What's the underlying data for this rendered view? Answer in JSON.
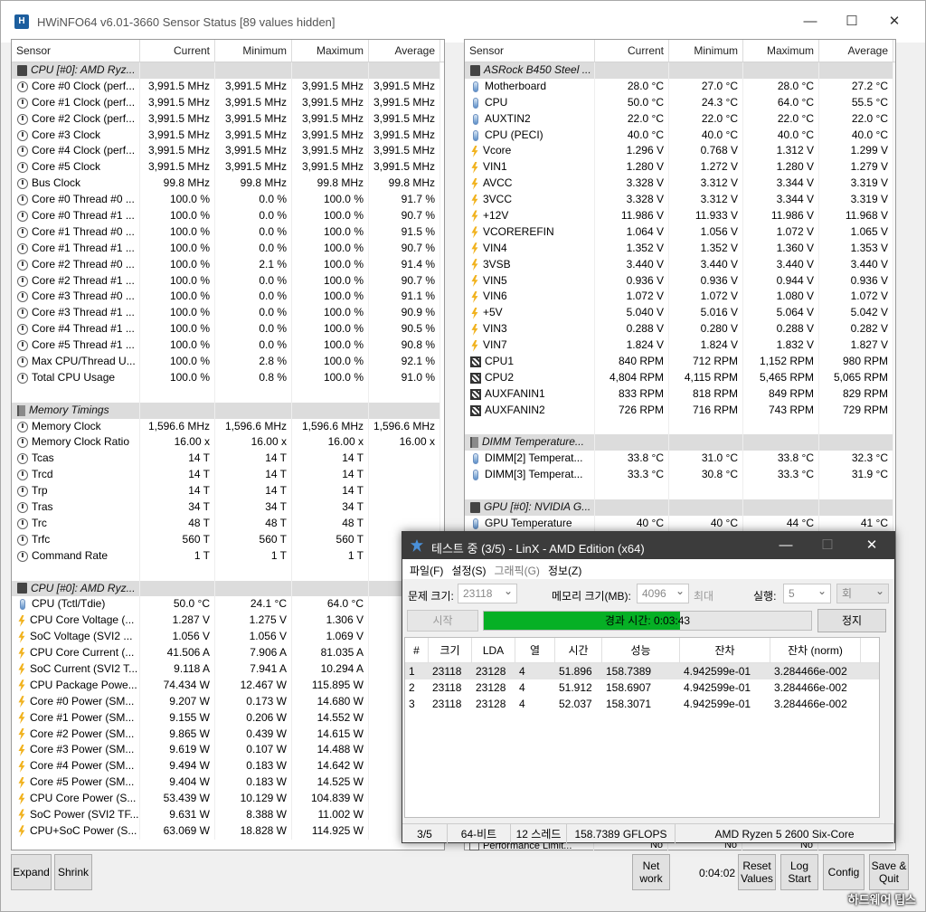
{
  "hwinfo": {
    "title": "HWiNFO64 v6.01-3660 Sensor Status [89 values hidden]",
    "app_icon_text": "H",
    "headers": [
      "Sensor",
      "Current",
      "Minimum",
      "Maximum",
      "Average"
    ],
    "left_rows": [
      {
        "t": "g",
        "icon": "chip",
        "name": "CPU [#0]: AMD Ryz..."
      },
      {
        "icon": "clock",
        "name": "Core #0 Clock (perf...",
        "cur": "3,991.5 MHz",
        "min": "3,991.5 MHz",
        "max": "3,991.5 MHz",
        "avg": "3,991.5 MHz"
      },
      {
        "icon": "clock",
        "name": "Core #1 Clock (perf...",
        "cur": "3,991.5 MHz",
        "min": "3,991.5 MHz",
        "max": "3,991.5 MHz",
        "avg": "3,991.5 MHz"
      },
      {
        "icon": "clock",
        "name": "Core #2 Clock (perf...",
        "cur": "3,991.5 MHz",
        "min": "3,991.5 MHz",
        "max": "3,991.5 MHz",
        "avg": "3,991.5 MHz"
      },
      {
        "icon": "clock",
        "name": "Core #3 Clock",
        "cur": "3,991.5 MHz",
        "min": "3,991.5 MHz",
        "max": "3,991.5 MHz",
        "avg": "3,991.5 MHz"
      },
      {
        "icon": "clock",
        "name": "Core #4 Clock (perf...",
        "cur": "3,991.5 MHz",
        "min": "3,991.5 MHz",
        "max": "3,991.5 MHz",
        "avg": "3,991.5 MHz"
      },
      {
        "icon": "clock",
        "name": "Core #5 Clock",
        "cur": "3,991.5 MHz",
        "min": "3,991.5 MHz",
        "max": "3,991.5 MHz",
        "avg": "3,991.5 MHz"
      },
      {
        "icon": "clock",
        "name": "Bus Clock",
        "cur": "99.8 MHz",
        "min": "99.8 MHz",
        "max": "99.8 MHz",
        "avg": "99.8 MHz"
      },
      {
        "icon": "clock",
        "name": "Core #0 Thread #0 ...",
        "cur": "100.0 %",
        "min": "0.0 %",
        "max": "100.0 %",
        "avg": "91.7 %"
      },
      {
        "icon": "clock",
        "name": "Core #0 Thread #1 ...",
        "cur": "100.0 %",
        "min": "0.0 %",
        "max": "100.0 %",
        "avg": "90.7 %"
      },
      {
        "icon": "clock",
        "name": "Core #1 Thread #0 ...",
        "cur": "100.0 %",
        "min": "0.0 %",
        "max": "100.0 %",
        "avg": "91.5 %"
      },
      {
        "icon": "clock",
        "name": "Core #1 Thread #1 ...",
        "cur": "100.0 %",
        "min": "0.0 %",
        "max": "100.0 %",
        "avg": "90.7 %"
      },
      {
        "icon": "clock",
        "name": "Core #2 Thread #0 ...",
        "cur": "100.0 %",
        "min": "2.1 %",
        "max": "100.0 %",
        "avg": "91.4 %"
      },
      {
        "icon": "clock",
        "name": "Core #2 Thread #1 ...",
        "cur": "100.0 %",
        "min": "0.0 %",
        "max": "100.0 %",
        "avg": "90.7 %"
      },
      {
        "icon": "clock",
        "name": "Core #3 Thread #0 ...",
        "cur": "100.0 %",
        "min": "0.0 %",
        "max": "100.0 %",
        "avg": "91.1 %"
      },
      {
        "icon": "clock",
        "name": "Core #3 Thread #1 ...",
        "cur": "100.0 %",
        "min": "0.0 %",
        "max": "100.0 %",
        "avg": "90.9 %"
      },
      {
        "icon": "clock",
        "name": "Core #4 Thread #1 ...",
        "cur": "100.0 %",
        "min": "0.0 %",
        "max": "100.0 %",
        "avg": "90.5 %"
      },
      {
        "icon": "clock",
        "name": "Core #5 Thread #1 ...",
        "cur": "100.0 %",
        "min": "0.0 %",
        "max": "100.0 %",
        "avg": "90.8 %"
      },
      {
        "icon": "clock",
        "name": "Max CPU/Thread U...",
        "cur": "100.0 %",
        "min": "2.8 %",
        "max": "100.0 %",
        "avg": "92.1 %"
      },
      {
        "icon": "clock",
        "name": "Total CPU Usage",
        "cur": "100.0 %",
        "min": "0.8 %",
        "max": "100.0 %",
        "avg": "91.0 %"
      },
      {
        "t": "e"
      },
      {
        "t": "g",
        "icon": "mem",
        "name": "Memory Timings"
      },
      {
        "icon": "clock",
        "name": "Memory Clock",
        "cur": "1,596.6 MHz",
        "min": "1,596.6 MHz",
        "max": "1,596.6 MHz",
        "avg": "1,596.6 MHz"
      },
      {
        "icon": "clock",
        "name": "Memory Clock Ratio",
        "cur": "16.00 x",
        "min": "16.00 x",
        "max": "16.00 x",
        "avg": "16.00 x"
      },
      {
        "icon": "clock",
        "name": "Tcas",
        "cur": "14 T",
        "min": "14 T",
        "max": "14 T",
        "avg": ""
      },
      {
        "icon": "clock",
        "name": "Trcd",
        "cur": "14 T",
        "min": "14 T",
        "max": "14 T",
        "avg": ""
      },
      {
        "icon": "clock",
        "name": "Trp",
        "cur": "14 T",
        "min": "14 T",
        "max": "14 T",
        "avg": ""
      },
      {
        "icon": "clock",
        "name": "Tras",
        "cur": "34 T",
        "min": "34 T",
        "max": "34 T",
        "avg": ""
      },
      {
        "icon": "clock",
        "name": "Trc",
        "cur": "48 T",
        "min": "48 T",
        "max": "48 T",
        "avg": ""
      },
      {
        "icon": "clock",
        "name": "Trfc",
        "cur": "560 T",
        "min": "560 T",
        "max": "560 T",
        "avg": ""
      },
      {
        "icon": "clock",
        "name": "Command Rate",
        "cur": "1 T",
        "min": "1 T",
        "max": "1 T",
        "avg": ""
      },
      {
        "t": "e"
      },
      {
        "t": "g",
        "icon": "chip",
        "name": "CPU [#0]: AMD Ryz..."
      },
      {
        "icon": "therm",
        "name": "CPU (Tctl/Tdie)",
        "cur": "50.0 °C",
        "min": "24.1 °C",
        "max": "64.0 °C",
        "avg": ""
      },
      {
        "icon": "volt",
        "name": "CPU Core Voltage (...",
        "cur": "1.287 V",
        "min": "1.275 V",
        "max": "1.306 V",
        "avg": ""
      },
      {
        "icon": "volt",
        "name": "SoC Voltage (SVI2 ...",
        "cur": "1.056 V",
        "min": "1.056 V",
        "max": "1.069 V",
        "avg": ""
      },
      {
        "icon": "volt",
        "name": "CPU Core Current (...",
        "cur": "41.506 A",
        "min": "7.906 A",
        "max": "81.035 A",
        "avg": "6"
      },
      {
        "icon": "volt",
        "name": "SoC Current (SVI2 T...",
        "cur": "9.118 A",
        "min": "7.941 A",
        "max": "10.294 A",
        "avg": ""
      },
      {
        "icon": "volt",
        "name": "CPU Package Powe...",
        "cur": "74.434 W",
        "min": "12.467 W",
        "max": "115.895 W",
        "avg": "9"
      },
      {
        "icon": "volt",
        "name": "Core #0 Power (SM...",
        "cur": "9.207 W",
        "min": "0.173 W",
        "max": "14.680 W",
        "avg": "1"
      },
      {
        "icon": "volt",
        "name": "Core #1 Power (SM...",
        "cur": "9.155 W",
        "min": "0.206 W",
        "max": "14.552 W",
        "avg": "1"
      },
      {
        "icon": "volt",
        "name": "Core #2 Power (SM...",
        "cur": "9.865 W",
        "min": "0.439 W",
        "max": "14.615 W",
        "avg": "1"
      },
      {
        "icon": "volt",
        "name": "Core #3 Power (SM...",
        "cur": "9.619 W",
        "min": "0.107 W",
        "max": "14.488 W",
        "avg": "1"
      },
      {
        "icon": "volt",
        "name": "Core #4 Power (SM...",
        "cur": "9.494 W",
        "min": "0.183 W",
        "max": "14.642 W",
        "avg": "1"
      },
      {
        "icon": "volt",
        "name": "Core #5 Power (SM...",
        "cur": "9.404 W",
        "min": "0.183 W",
        "max": "14.525 W",
        "avg": "1"
      },
      {
        "icon": "volt",
        "name": "CPU Core Power (S...",
        "cur": "53.439 W",
        "min": "10.129 W",
        "max": "104.839 W",
        "avg": "7"
      },
      {
        "icon": "volt",
        "name": "SoC Power (SVI2 TF...",
        "cur": "9.631 W",
        "min": "8.388 W",
        "max": "11.002 W",
        "avg": "9"
      },
      {
        "icon": "volt",
        "name": "CPU+SoC Power (S...",
        "cur": "63.069 W",
        "min": "18.828 W",
        "max": "114.925 W",
        "avg": "8"
      }
    ],
    "right_rows": [
      {
        "t": "g",
        "icon": "chip",
        "name": "ASRock B450 Steel ..."
      },
      {
        "icon": "therm",
        "name": "Motherboard",
        "cur": "28.0 °C",
        "min": "27.0 °C",
        "max": "28.0 °C",
        "avg": "27.2 °C"
      },
      {
        "icon": "therm",
        "name": "CPU",
        "cur": "50.0 °C",
        "min": "24.3 °C",
        "max": "64.0 °C",
        "avg": "55.5 °C"
      },
      {
        "icon": "therm",
        "name": "AUXTIN2",
        "cur": "22.0 °C",
        "min": "22.0 °C",
        "max": "22.0 °C",
        "avg": "22.0 °C"
      },
      {
        "icon": "therm",
        "name": "CPU (PECI)",
        "cur": "40.0 °C",
        "min": "40.0 °C",
        "max": "40.0 °C",
        "avg": "40.0 °C"
      },
      {
        "icon": "volt",
        "name": "Vcore",
        "cur": "1.296 V",
        "min": "0.768 V",
        "max": "1.312 V",
        "avg": "1.299 V"
      },
      {
        "icon": "volt",
        "name": "VIN1",
        "cur": "1.280 V",
        "min": "1.272 V",
        "max": "1.280 V",
        "avg": "1.279 V"
      },
      {
        "icon": "volt",
        "name": "AVCC",
        "cur": "3.328 V",
        "min": "3.312 V",
        "max": "3.344 V",
        "avg": "3.319 V"
      },
      {
        "icon": "volt",
        "name": "3VCC",
        "cur": "3.328 V",
        "min": "3.312 V",
        "max": "3.344 V",
        "avg": "3.319 V"
      },
      {
        "icon": "volt",
        "name": "+12V",
        "cur": "11.986 V",
        "min": "11.933 V",
        "max": "11.986 V",
        "avg": "11.968 V"
      },
      {
        "icon": "volt",
        "name": "VCOREREFIN",
        "cur": "1.064 V",
        "min": "1.056 V",
        "max": "1.072 V",
        "avg": "1.065 V"
      },
      {
        "icon": "volt",
        "name": "VIN4",
        "cur": "1.352 V",
        "min": "1.352 V",
        "max": "1.360 V",
        "avg": "1.353 V"
      },
      {
        "icon": "volt",
        "name": "3VSB",
        "cur": "3.440 V",
        "min": "3.440 V",
        "max": "3.440 V",
        "avg": "3.440 V"
      },
      {
        "icon": "volt",
        "name": "VIN5",
        "cur": "0.936 V",
        "min": "0.936 V",
        "max": "0.944 V",
        "avg": "0.936 V"
      },
      {
        "icon": "volt",
        "name": "VIN6",
        "cur": "1.072 V",
        "min": "1.072 V",
        "max": "1.080 V",
        "avg": "1.072 V"
      },
      {
        "icon": "volt",
        "name": "+5V",
        "cur": "5.040 V",
        "min": "5.016 V",
        "max": "5.064 V",
        "avg": "5.042 V"
      },
      {
        "icon": "volt",
        "name": "VIN3",
        "cur": "0.288 V",
        "min": "0.280 V",
        "max": "0.288 V",
        "avg": "0.282 V"
      },
      {
        "icon": "volt",
        "name": "VIN7",
        "cur": "1.824 V",
        "min": "1.824 V",
        "max": "1.832 V",
        "avg": "1.827 V"
      },
      {
        "icon": "fan",
        "name": "CPU1",
        "cur": "840 RPM",
        "min": "712 RPM",
        "max": "1,152 RPM",
        "avg": "980 RPM"
      },
      {
        "icon": "fan",
        "name": "CPU2",
        "cur": "4,804 RPM",
        "min": "4,115 RPM",
        "max": "5,465 RPM",
        "avg": "5,065 RPM"
      },
      {
        "icon": "fan",
        "name": "AUXFANIN1",
        "cur": "833 RPM",
        "min": "818 RPM",
        "max": "849 RPM",
        "avg": "829 RPM"
      },
      {
        "icon": "fan",
        "name": "AUXFANIN2",
        "cur": "726 RPM",
        "min": "716 RPM",
        "max": "743 RPM",
        "avg": "729 RPM"
      },
      {
        "t": "e"
      },
      {
        "t": "g",
        "icon": "mem",
        "name": "DIMM Temperature..."
      },
      {
        "icon": "therm",
        "name": "DIMM[2] Temperat...",
        "cur": "33.8 °C",
        "min": "31.0 °C",
        "max": "33.8 °C",
        "avg": "32.3 °C"
      },
      {
        "icon": "therm",
        "name": "DIMM[3] Temperat...",
        "cur": "33.3 °C",
        "min": "30.8 °C",
        "max": "33.3 °C",
        "avg": "31.9 °C"
      },
      {
        "t": "e"
      },
      {
        "t": "g",
        "icon": "chip",
        "name": "GPU [#0]: NVIDIA G..."
      },
      {
        "icon": "therm",
        "name": "GPU Temperature",
        "cur": "40 °C",
        "min": "40 °C",
        "max": "44 °C",
        "avg": "41 °C"
      }
    ],
    "partial_row": {
      "name": "Performance Limit...",
      "cur": "No",
      "min": "No",
      "max": "No"
    },
    "buttons": {
      "expand": "Expand",
      "shrink": "Shrink",
      "network": "Net\nwork",
      "reset": "Reset\nValues",
      "log": "Log\nStart",
      "config": "Config",
      "savequit": "Save &\nQuit"
    },
    "timer": "0:04:02",
    "watermark": "하드웨어 팁스"
  },
  "linx": {
    "title": "테스트 중 (3/5) - LinX - AMD Edition (x64)",
    "menu": [
      "파일(F)",
      "설정(S)",
      "그래픽(G)",
      "정보(Z)"
    ],
    "problem_size_label": "문제 크기:",
    "problem_size": "23118",
    "memory_label": "메모리 크기(MB):",
    "memory_value": "4096",
    "max_label": "최대",
    "run_label": "실행:",
    "run_count": "5",
    "run_unit": "회",
    "start_button": "시작",
    "elapsed": "경과 시간: 0:03:43",
    "progress": 0.6,
    "stop_button": "정지",
    "accent": "#06b025",
    "columns": [
      "#",
      "크기",
      "LDA",
      "열",
      "시간",
      "성능",
      "잔차",
      "잔차 (norm)"
    ],
    "rows": [
      [
        "1",
        "23118",
        "23128",
        "4",
        "51.896",
        "158.7389",
        "4.942599e-01",
        "3.284466e-002"
      ],
      [
        "2",
        "23118",
        "23128",
        "4",
        "51.912",
        "158.6907",
        "4.942599e-01",
        "3.284466e-002"
      ],
      [
        "3",
        "23118",
        "23128",
        "4",
        "52.037",
        "158.3071",
        "4.942599e-01",
        "3.284466e-002"
      ]
    ],
    "status": [
      "3/5",
      "64-비트",
      "12 스레드",
      "158.7389 GFLOPS",
      "AMD Ryzen 5 2600 Six-Core"
    ]
  }
}
